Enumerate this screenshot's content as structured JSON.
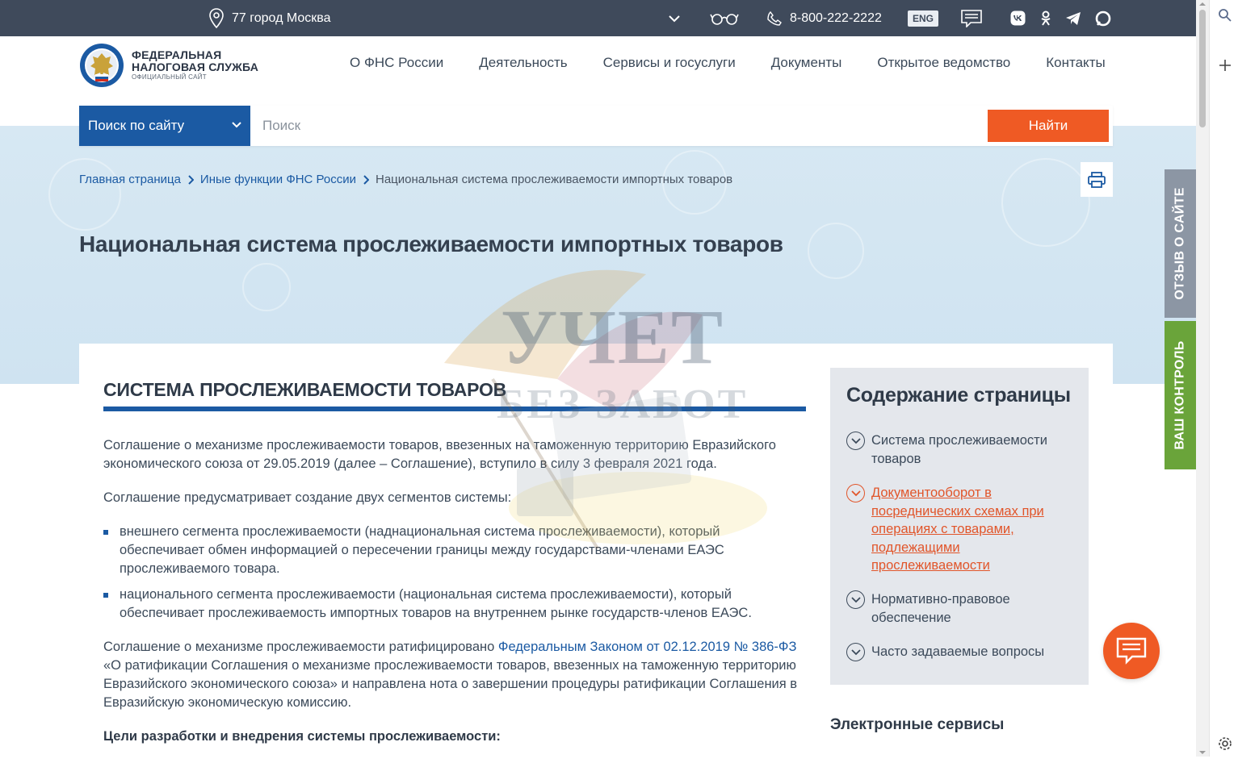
{
  "topbar": {
    "region": "77 город Москва",
    "phone": "8-800-222-2222",
    "lang": "ENG",
    "social": [
      "vk-icon",
      "ok-icon",
      "telegram-icon",
      "rutube-icon"
    ]
  },
  "logo": {
    "line1": "ФЕДЕРАЛЬНАЯ",
    "line2": "НАЛОГОВАЯ СЛУЖБА",
    "line3": "ОФИЦИАЛЬНЫЙ САЙТ"
  },
  "nav": [
    "О ФНС России",
    "Деятельность",
    "Сервисы и госуслуги",
    "Документы",
    "Открытое ведомство",
    "Контакты"
  ],
  "search": {
    "scope": "Поиск по сайту",
    "placeholder": "Поиск",
    "button": "Найти"
  },
  "breadcrumb": {
    "home": "Главная страница",
    "section": "Иные функции ФНС России",
    "current": "Национальная система прослеживаемости импортных товаров"
  },
  "page_title": "Национальная система прослеживаемости импортных товаров",
  "watermark": {
    "line1": "УЧЕТ",
    "line2": "БЕЗ ЗАБОТ"
  },
  "section": {
    "title": "СИСТЕМА ПРОСЛЕЖИВАЕМОСТИ ТОВАРОВ",
    "p1": "Соглашение о механизме прослеживаемости товаров, ввезенных на таможенную территорию Евразийского экономического союза от 29.05.2019 (далее – Соглашение), вступило в силу 3 февраля 2021 года.",
    "p2": "Соглашение предусматривает создание двух сегментов системы:",
    "bullets": [
      "внешнего сегмента прослеживаемости (наднациональная система прослеживаемости), который обеспечивает обмен информацией о пересечении границы между государствами-членами ЕАЭС прослеживаемого товара.",
      "национального сегмента прослеживаемости (национальная система прослеживаемости), который обеспечивает прослеживаемость импортных товаров на внутреннем рынке государств-членов ЕАЭС."
    ],
    "p3_before": "Соглашение о механизме прослеживаемости ратифицировано ",
    "p3_link": "Федеральным Законом от 02.12.2019 № 386-ФЗ",
    "p3_after": " «О ратификации Соглашения о механизме прослеживаемости товаров, ввезенных на таможенную территорию Евразийского экономического союза» и направлена нота о завершении процедуры ратификации Соглашения в Евразийскую экономическую комиссию.",
    "subhead": "Цели разработки и внедрения системы прослеживаемости:"
  },
  "toc": {
    "title": "Содержание страницы",
    "items": [
      "Система прослеживаемости товаров",
      "Документооборот в посреднических схемах при операциях с товарами, подлежащими прослеживаемости",
      "Нормативно-правовое обеспечение",
      "Часто задаваемые вопросы"
    ]
  },
  "eservices_title": "Электронные сервисы",
  "side_tabs": {
    "feedback": "ОТЗЫВ О САЙТЕ",
    "control": "ВАШ КОНТРОЛЬ"
  },
  "colors": {
    "topbar": "#3f4a5b",
    "brand_blue": "#1b5aa3",
    "accent_orange": "#ef5a24",
    "feedback_tab": "#8c96a4",
    "control_tab": "#6aa43a"
  }
}
